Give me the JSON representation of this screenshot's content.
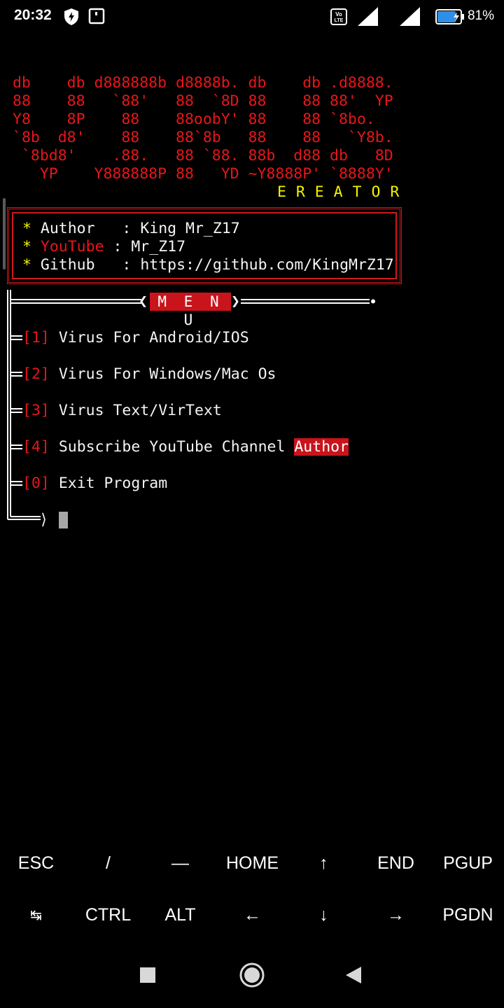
{
  "status_bar": {
    "time": "20:32",
    "battery_percent": "81%",
    "icons": [
      "data-saver-icon",
      "screenshot-notification-icon",
      "volte-icon",
      "signal-icon",
      "signal-icon-2",
      "battery-icon"
    ],
    "volte_label": "Vo LTE"
  },
  "banner": {
    "ascii_lines": [
      "db    db d888888b d8888b. db    db .d8888.",
      "88    88   `88'   88  `8D 88    88 88'  YP",
      "Y8    8P    88    88oobY' 88    88 `8bo.",
      "`8b  d8'    88    88`8b   88    88   `Y8b.",
      " `8bd8'    .88.   88 `88. 88b  d88 db   8D",
      "   YP    Y888888P 88   YD ~Y8888P' `8888Y'"
    ],
    "subtitle": "E R E A T O R"
  },
  "info": {
    "author_label": "Author",
    "author_sep": " : ",
    "author_value": "King Mr_Z17",
    "youtube_label": "YouTube",
    "youtube_sep": " : ",
    "youtube_value": "Mr_Z17",
    "github_label": "Github",
    "github_sep": " : ",
    "github_value": "https://github.com/KingMrZ17",
    "bullet": "*"
  },
  "menu": {
    "title": "M E N U",
    "items": [
      {
        "num": "1",
        "label": "Virus For Android/IOS"
      },
      {
        "num": "2",
        "label": "Virus For Windows/Mac Os"
      },
      {
        "num": "3",
        "label": "Virus Text/VirText"
      },
      {
        "num": "4",
        "label": "Subscribe YouTube Channel ",
        "highlight": "Author"
      },
      {
        "num": "0",
        "label": "Exit Program"
      }
    ],
    "prompt_arrow": "⟩"
  },
  "extra_keys": {
    "row1": [
      "ESC",
      "/",
      "—",
      "HOME",
      "↑",
      "END",
      "PGUP"
    ],
    "row2": [
      "↹",
      "CTRL",
      "ALT",
      "←",
      "↓",
      "→",
      "PGDN"
    ]
  },
  "colors": {
    "accent_red": "#e8161a",
    "highlight_red": "#c9141b",
    "yellow": "#f2f200"
  }
}
